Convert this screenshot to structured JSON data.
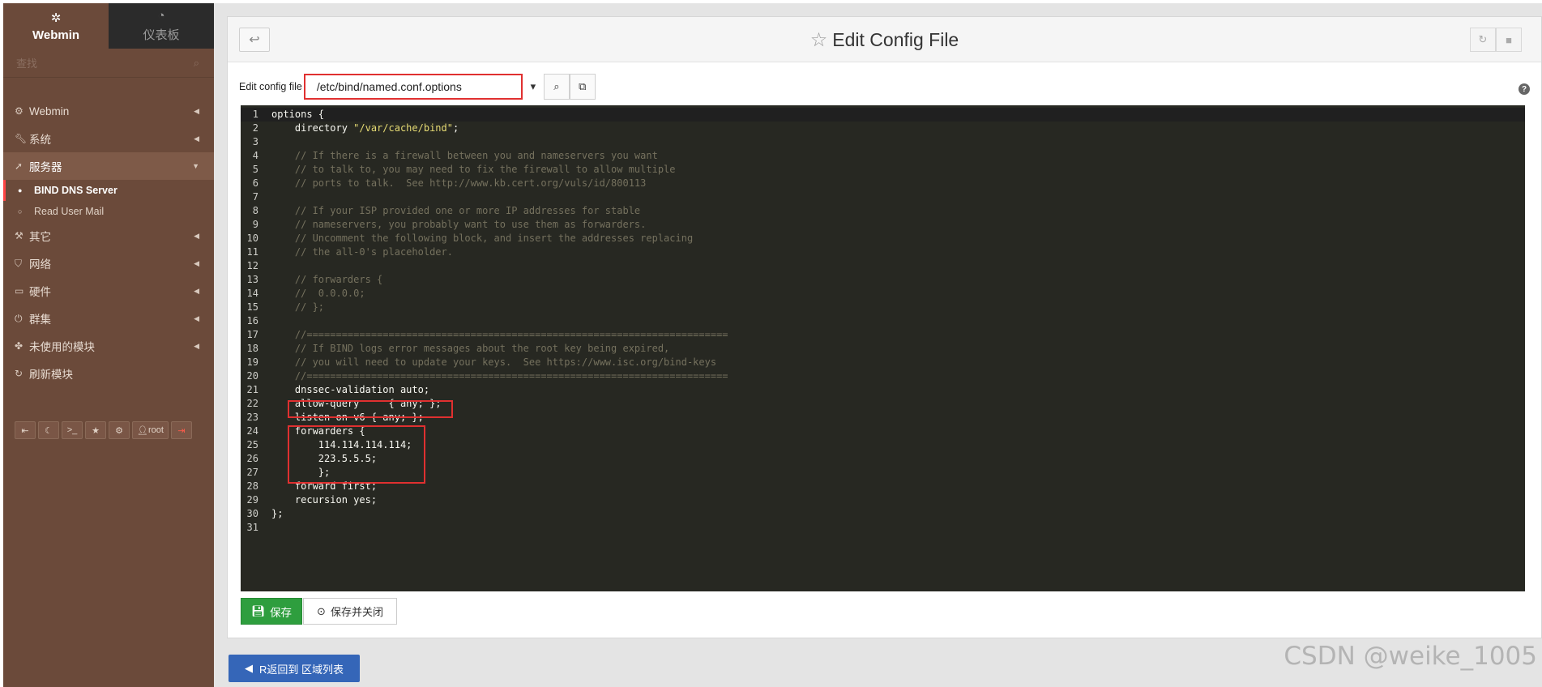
{
  "sidebar": {
    "tabs": [
      {
        "label": "Webmin",
        "icon": "webmin-logo-icon"
      },
      {
        "label": "仪表板",
        "icon": "dashboard-icon"
      }
    ],
    "search_placeholder": "查找",
    "menu": [
      {
        "label": "Webmin",
        "icon": "gear-icon"
      },
      {
        "label": "系统",
        "icon": "wrench-icon"
      },
      {
        "label": "服务器",
        "icon": "rocket-icon"
      },
      {
        "label": "其它",
        "icon": "gavel-icon"
      },
      {
        "label": "网络",
        "icon": "shield-icon"
      },
      {
        "label": "硬件",
        "icon": "hdd-icon"
      },
      {
        "label": "群集",
        "icon": "power-icon"
      },
      {
        "label": "未使用的模块",
        "icon": "puzzle-icon"
      },
      {
        "label": "刷新模块",
        "icon": "refresh-icon"
      }
    ],
    "submenu": [
      {
        "label": "BIND DNS Server"
      },
      {
        "label": "Read User Mail"
      }
    ],
    "tools": {
      "user_label": "root"
    }
  },
  "header": {
    "title": "Edit Config File"
  },
  "file": {
    "label": "Edit config file",
    "selected": "/etc/bind/named.conf.options"
  },
  "editor": {
    "lines": [
      "options {",
      "    directory \"/var/cache/bind\";",
      "",
      "    // If there is a firewall between you and nameservers you want",
      "    // to talk to, you may need to fix the firewall to allow multiple",
      "    // ports to talk.  See http://www.kb.cert.org/vuls/id/800113",
      "",
      "    // If your ISP provided one or more IP addresses for stable",
      "    // nameservers, you probably want to use them as forwarders.",
      "    // Uncomment the following block, and insert the addresses replacing",
      "    // the all-0's placeholder.",
      "",
      "    // forwarders {",
      "    //  0.0.0.0;",
      "    // };",
      "",
      "    //========================================================================",
      "    // If BIND logs error messages about the root key being expired,",
      "    // you will need to update your keys.  See https://www.isc.org/bind-keys",
      "    //========================================================================",
      "    dnssec-validation auto;",
      "    allow-query     { any; };",
      "    listen-on-v6 { any; };",
      "    forwarders {",
      "        114.114.114.114;",
      "        223.5.5.5;",
      "        };",
      "    forward first;",
      "    recursion yes;",
      "};",
      ""
    ]
  },
  "buttons": {
    "save": "保存",
    "save_close": "保存并关闭",
    "return": "R返回到 区域列表"
  },
  "watermark": "CSDN @weike_1005"
}
